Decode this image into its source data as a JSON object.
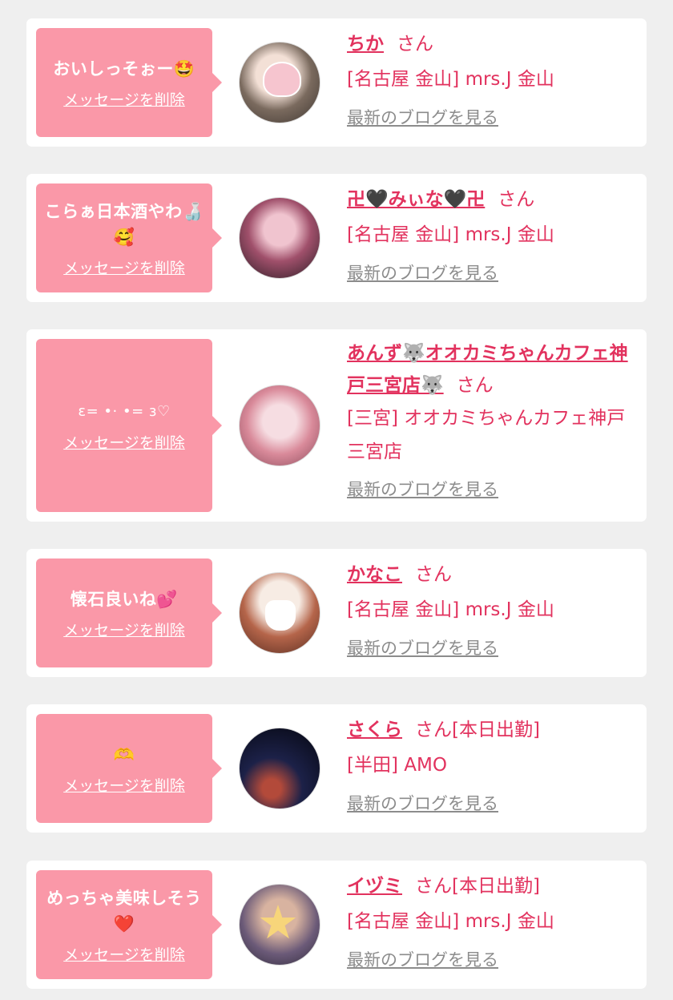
{
  "common": {
    "delete_label": "メッセージを削除",
    "blog_label": "最新のブログを見る",
    "san": "さん"
  },
  "items": [
    {
      "message": "おいしっそぉー🤩",
      "name": "ちか",
      "suffix": "さん",
      "shop": "[名古屋 金山] mrs.J 金山"
    },
    {
      "message": "こらぁ日本酒やわ🍶🥰",
      "name": "卍🖤みぃな🖤卍",
      "suffix": "さん",
      "shop": "[名古屋 金山] mrs.J 金山"
    },
    {
      "message": "ε= •· •= з♡",
      "name": "あんず🐺オオカミちゃんカフェ神戸三宮店🐺",
      "suffix": "さん",
      "shop": "[三宮] オオカミちゃんカフェ神戸三宮店"
    },
    {
      "message": "懐石良いね💕",
      "name": "かなこ",
      "suffix": "さん",
      "shop": "[名古屋 金山] mrs.J 金山"
    },
    {
      "message": "🫶",
      "name": "さくら",
      "suffix": "さん[本日出勤]",
      "shop": "[半田] AMO"
    },
    {
      "message": "めっちゃ美味しそう❤️",
      "name": "イヅミ",
      "suffix": "さん[本日出勤]",
      "shop": "[名古屋 金山] mrs.J 金山"
    }
  ],
  "colors": {
    "page_bg": "#efefef",
    "card_bg": "#ffffff",
    "bubble_bg": "#fa98a8",
    "name_color": "#e2325e",
    "blog_color": "#8c8c8c"
  }
}
